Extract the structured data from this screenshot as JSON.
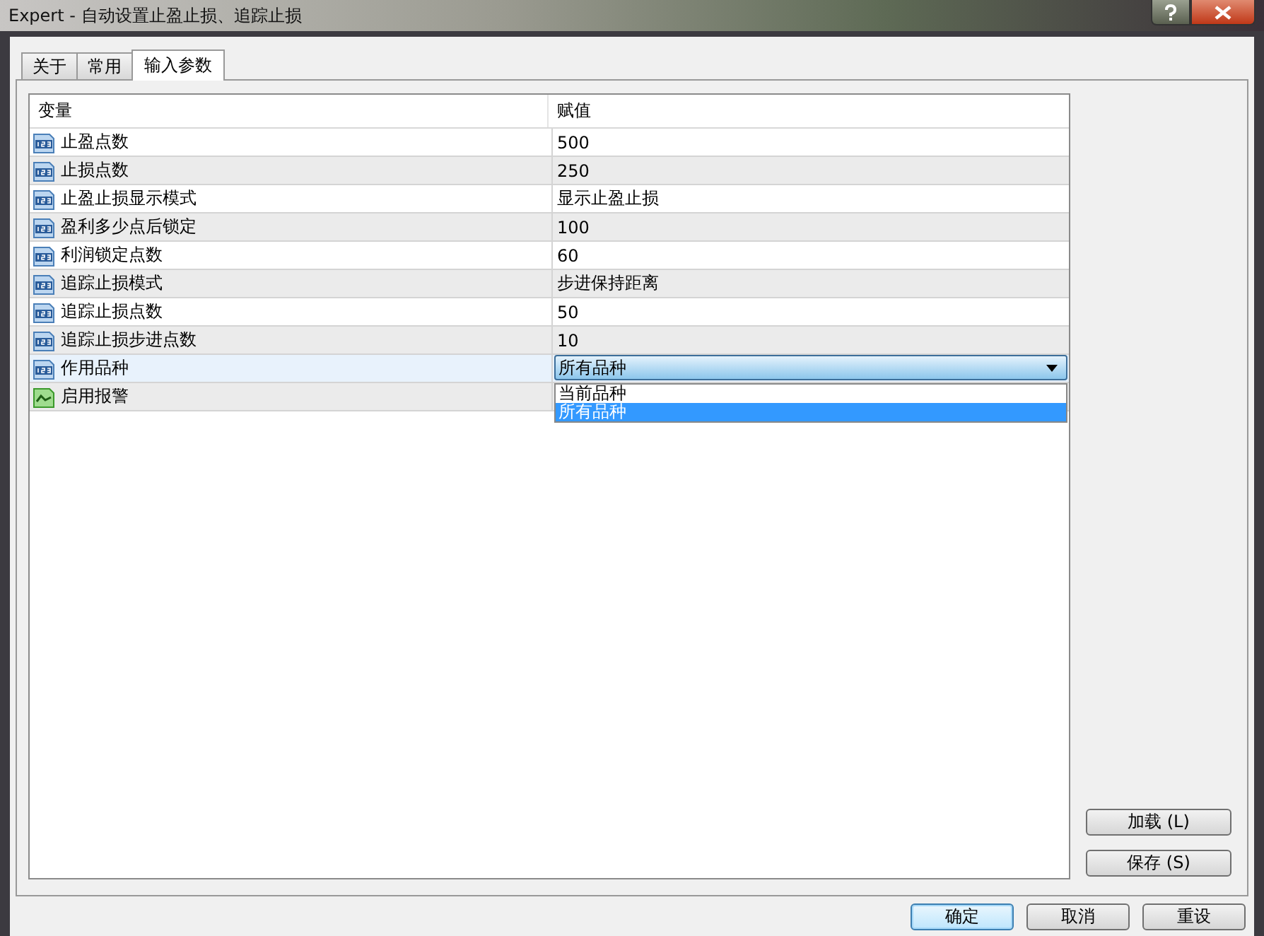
{
  "window": {
    "title": "Expert - 自动设置止盈止损、追踪止损"
  },
  "tabs": [
    {
      "label": "关于",
      "selected": false
    },
    {
      "label": "常用",
      "selected": false
    },
    {
      "label": "输入参数",
      "selected": true
    }
  ],
  "table": {
    "columns": [
      "变量",
      "赋值"
    ],
    "rows": [
      {
        "kind": "number",
        "name": "止盈点数",
        "value": "500",
        "selected": false
      },
      {
        "kind": "number",
        "name": "止损点数",
        "value": "250",
        "selected": false
      },
      {
        "kind": "number",
        "name": "止盈止损显示模式",
        "value": "显示止盈止损",
        "selected": false
      },
      {
        "kind": "number",
        "name": "盈利多少点后锁定",
        "value": "100",
        "selected": false
      },
      {
        "kind": "number",
        "name": "利润锁定点数",
        "value": "60",
        "selected": false
      },
      {
        "kind": "number",
        "name": "追踪止损模式",
        "value": "步进保持距离",
        "selected": false
      },
      {
        "kind": "number",
        "name": "追踪止损点数",
        "value": "50",
        "selected": false
      },
      {
        "kind": "number",
        "name": "追踪止损步进点数",
        "value": "10",
        "selected": false
      },
      {
        "kind": "number",
        "name": "作用品种",
        "selected": true,
        "dropdown": {
          "value": "所有品种",
          "options": [
            {
              "label": "当前品种",
              "selected": false
            },
            {
              "label": "所有品种",
              "selected": true
            }
          ]
        }
      },
      {
        "kind": "bool",
        "name": "启用报警",
        "selected": false
      }
    ]
  },
  "side_buttons": [
    "加载 (L)",
    "保存 (S)"
  ],
  "buttons": [
    {
      "label": "确定",
      "default": true
    },
    {
      "label": "取消",
      "default": false
    },
    {
      "label": "重设",
      "default": false
    }
  ]
}
